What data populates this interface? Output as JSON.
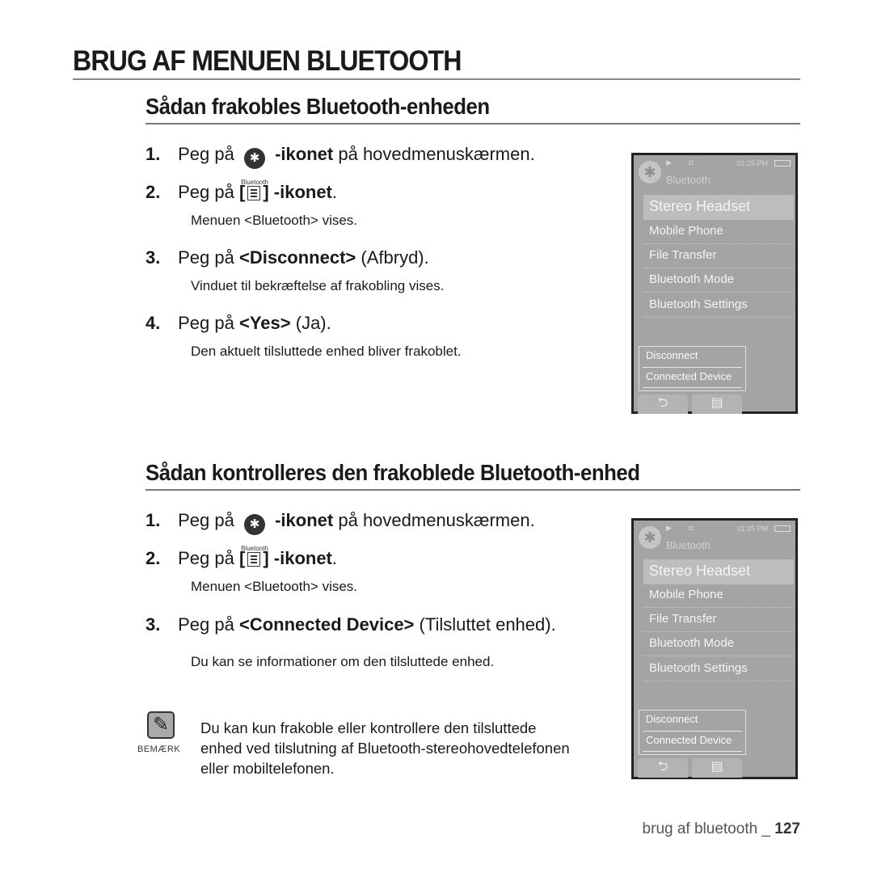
{
  "page": {
    "title": "BRUG AF MENUEN BLUETOOTH",
    "footer": {
      "section": "brug af bluetooth _",
      "page_number": "127"
    }
  },
  "icons": {
    "bluetooth_caption": "Bluetooth",
    "bluetooth_glyph": "✱",
    "menu_glyph": "menu-list",
    "note_glyph": "✎"
  },
  "section1": {
    "heading": "Sådan frakobles Bluetooth-enheden",
    "steps": [
      {
        "num": "1.",
        "pre": "Peg på",
        "bold": "-ikonet",
        "post": "på hovedmenuskærmen."
      },
      {
        "num": "2.",
        "pre": "Peg på",
        "bracket_open": "[",
        "bracket_close": "]",
        "bold": "-ikonet",
        "post": ".",
        "sub": "Menuen <Bluetooth> vises."
      },
      {
        "num": "3.",
        "pre": "Peg på",
        "bold": "<Disconnect>",
        "post": "(Afbryd).",
        "sub": "Vinduet til bekræftelse af frakobling vises."
      },
      {
        "num": "4.",
        "pre": "Peg på",
        "bold": "<Yes>",
        "post": "(Ja).",
        "sub": "Den aktuelt tilsluttede enhed bliver frakoblet."
      }
    ]
  },
  "section2": {
    "heading": "Sådan kontrolleres den frakoblede Bluetooth-enhed",
    "steps": [
      {
        "num": "1.",
        "pre": "Peg på",
        "bold": "-ikonet",
        "post": "på hovedmenuskærmen."
      },
      {
        "num": "2.",
        "pre": "Peg på",
        "bracket_open": "[",
        "bracket_close": "]",
        "bold": "-ikonet",
        "post": ".",
        "sub": "Menuen <Bluetooth> vises."
      },
      {
        "num": "3.",
        "pre": "Peg på",
        "bold": "<Connected Device>",
        "post": "(Tilsluttet enhed).",
        "sub": "Du kan se informationer om den tilsluttede enhed."
      }
    ]
  },
  "device_screen": {
    "status_time": "01:25 PM",
    "status_play": "▶",
    "status_headphone": "🎧",
    "title": "Bluetooth",
    "menu_items": [
      "Stereo Headset",
      "Mobile Phone",
      "File Transfer",
      "Bluetooth Mode",
      "Bluetooth Settings"
    ],
    "selected_item": "Stereo Headset",
    "popup_items": [
      "Disconnect",
      "Connected Device"
    ],
    "back_glyph": "⮌",
    "menu_button_glyph": "▤"
  },
  "note": {
    "label": "BEMÆRK",
    "text": "Du kan kun frakoble eller kontrollere den tilsluttede enhed ved tilslutning af Bluetooth-stereohovedtelefonen eller mobiltelefonen."
  }
}
